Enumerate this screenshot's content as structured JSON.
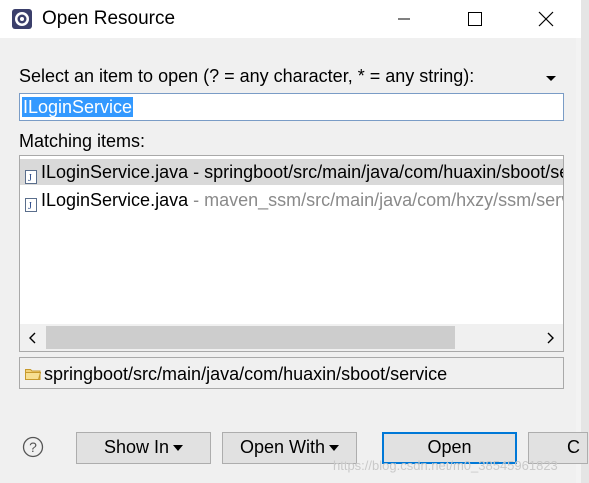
{
  "window": {
    "title": "Open Resource",
    "minimize_label": "minimize",
    "maximize_label": "maximize",
    "close_label": "close"
  },
  "dialog": {
    "prompt_label": "Select an item to open (? = any character, * = any string):",
    "search_value": "ILoginService",
    "matching_label": "Matching items:",
    "results": [
      {
        "name": "ILoginService.java",
        "separator": " - ",
        "path": "springboot/src/main/java/com/huaxin/sboot/service",
        "selected": true
      },
      {
        "name": "ILoginService.java",
        "separator": " - ",
        "path": "maven_ssm/src/main/java/com/hxzy/ssm/service",
        "selected": false
      }
    ],
    "selected_path": "springboot/src/main/java/com/huaxin/sboot/service"
  },
  "buttons": {
    "show_in": "Show In",
    "open_with": "Open With",
    "open": "Open",
    "cancel": "C"
  },
  "watermark": "https://blog.csdn.net/m0_38545961823",
  "icons": {
    "app": "eclipse-icon",
    "java_file": "java-file-icon",
    "folder": "folder-icon",
    "help": "help-icon"
  },
  "colors": {
    "selection": "#3399ff",
    "list_selected_row": "#d9d9d9",
    "default_button_border": "#0078d7",
    "dialog_bg": "#f0f0f0"
  }
}
